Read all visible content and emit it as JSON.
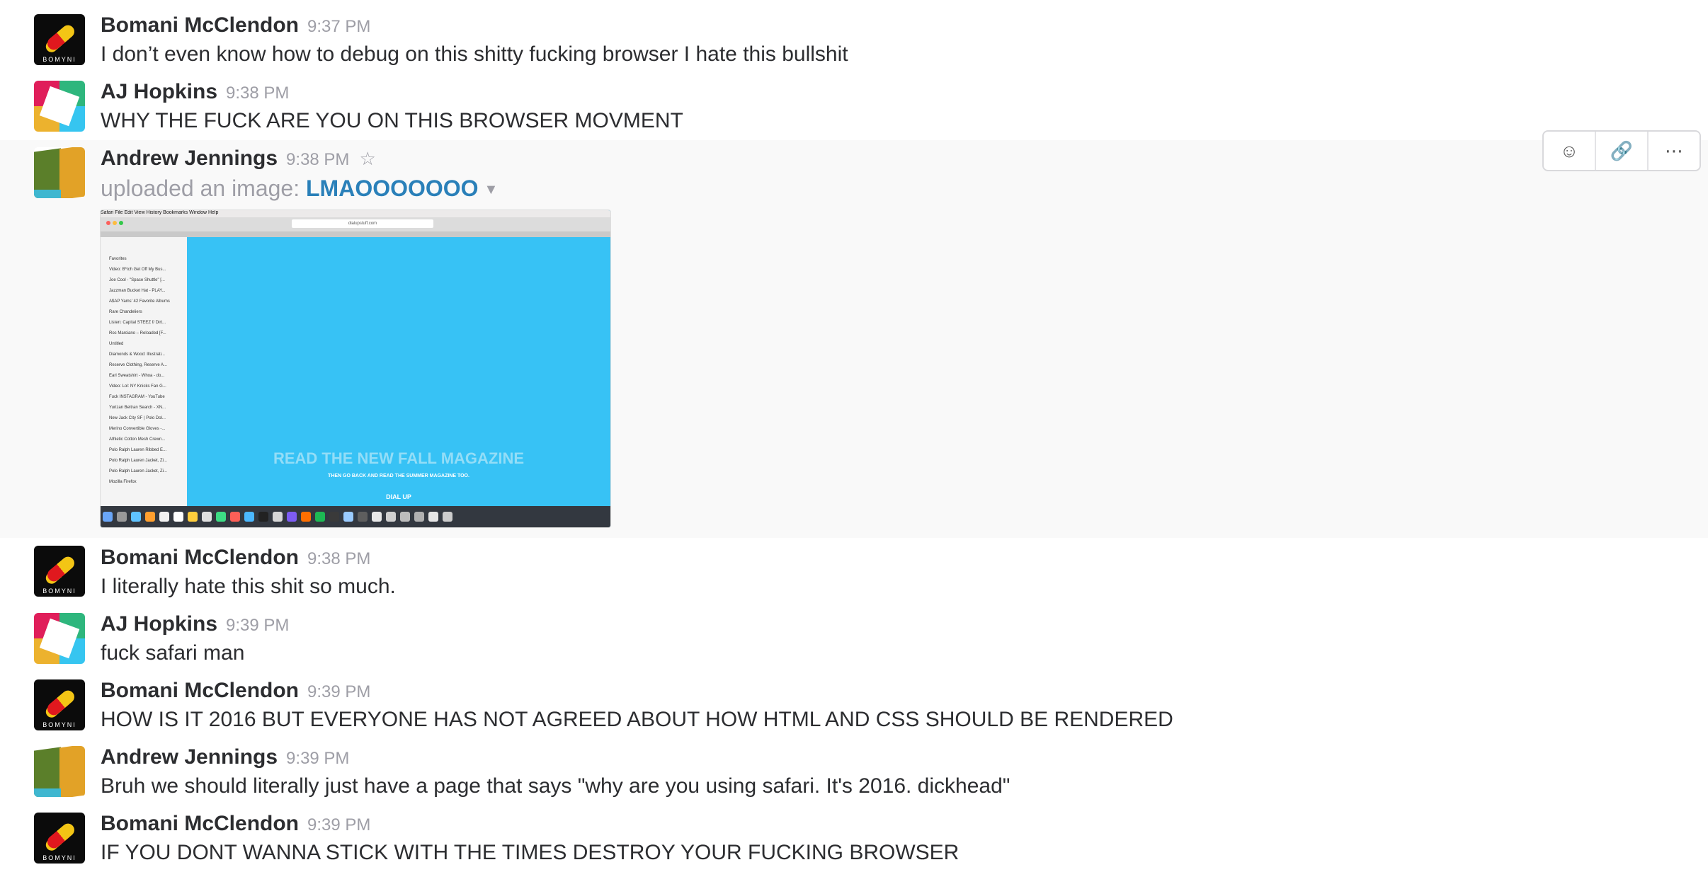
{
  "cutoff_text": "                                                                                      ",
  "hover_actions": {
    "reaction_icon": "add-reaction-icon",
    "link_icon": "link-icon",
    "more_icon": "more-actions-icon"
  },
  "messages": [
    {
      "author": "Bomani McClendon",
      "time": "9:37 PM",
      "text": "I don’t even know how to debug on this shitty fucking browser I hate this bullshit"
    },
    {
      "author": "AJ Hopkins",
      "time": "9:38 PM",
      "text": "WHY THE FUCK ARE YOU ON THIS BROWSER MOVMENT"
    },
    {
      "author": "Andrew Jennings",
      "time": "9:38 PM",
      "upload_prefix": "uploaded an image:",
      "upload_title": "LMAOOOOOOO"
    },
    {
      "author": "Bomani McClendon",
      "time": "9:38 PM",
      "text": "I literally hate this shit so much."
    },
    {
      "author": "AJ Hopkins",
      "time": "9:39 PM",
      "text": "fuck safari man"
    },
    {
      "author": "Bomani McClendon",
      "time": "9:39 PM",
      "text": "HOW IS IT 2016 BUT EVERYONE HAS NOT AGREED ABOUT HOW HTML AND CSS SHOULD BE RENDERED"
    },
    {
      "author": "Andrew Jennings",
      "time": "9:39 PM",
      "text": "Bruh we should literally just have a page that says \"why are you using safari. It's 2016. dickhead\""
    },
    {
      "author": "Bomani McClendon",
      "time": "9:39 PM",
      "text": "IF YOU DONT WANNA STICK WITH THE TIMES DESTROY YOUR FUCKING BROWSER"
    }
  ],
  "avatar_tag": "BOMYNI",
  "thumbnail": {
    "menubar": " Safari  File  Edit  View  History  Bookmarks  Window  Help",
    "url": "dialupstuff.com",
    "sidebar_items": [
      "Favorites",
      "Video: B*tch Get Off My Bus...",
      "Joe Cool - \"Space Shuttle\" [...",
      "Jazzman Bucket Hat - PLAY...",
      "A$AP Yams' 42 Favorite Albums",
      "Rare Chandeliers",
      "Listen: Capital STEEZ f/ Dirt...",
      "Roc Marciano – Reloaded [F...",
      "Untitled",
      "Diamonds & Wood: Illustrati...",
      "Reserve Clothing, Reserve A...",
      "Earl Sweatshirt - Whoa - do...",
      "Video: Lol: NY Knicks Fan G...",
      "Fuck INSTAGRAM - YouTube",
      "Yurizan Beltran Search - XN...",
      "New Jack City SF | Polo Dol...",
      "Merino Convertible Gloves -...",
      "Athletic Cotton Mesh Crewn...",
      "Polo Ralph Lauren Ribbed E...",
      "Polo Ralph Lauren Jacket, Zi...",
      "Polo Ralph Lauren Jacket, Zi...",
      "Mozilla Firefox"
    ],
    "headline": "READ THE NEW FALL MAGAZINE",
    "subline": "THEN GO BACK AND READ THE SUMMER MAGAZINE TOO.",
    "dial": "DIAL UP"
  }
}
